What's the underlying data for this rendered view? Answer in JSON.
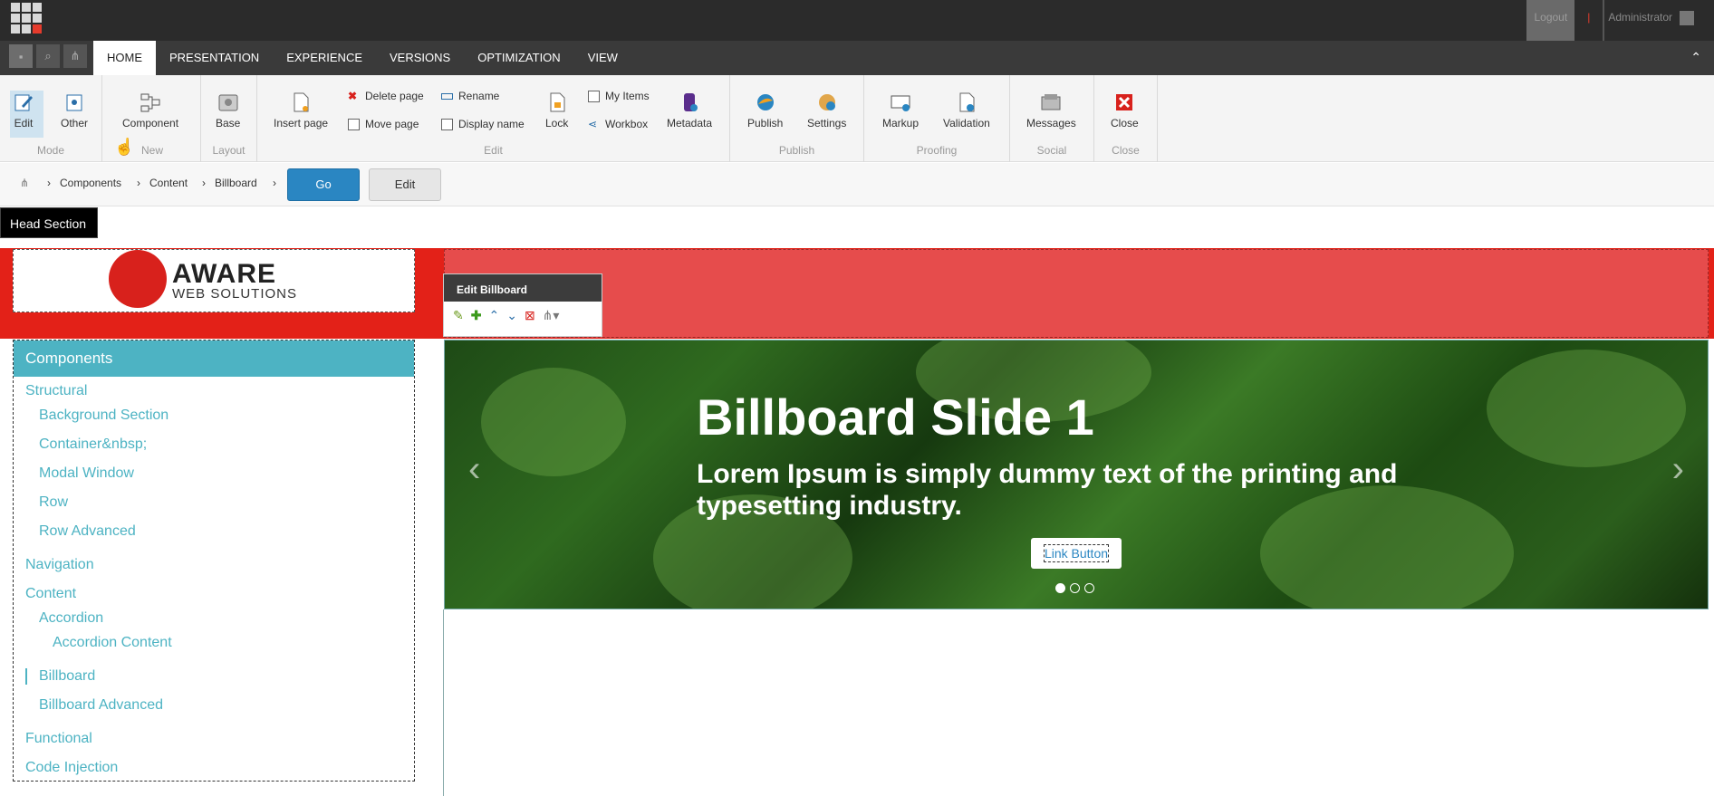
{
  "top": {
    "logout": "Logout",
    "separator": "|",
    "user": "Administrator"
  },
  "tabs": [
    "HOME",
    "PRESENTATION",
    "EXPERIENCE",
    "VERSIONS",
    "OPTIMIZATION",
    "VIEW"
  ],
  "ribbon": {
    "mode": {
      "label": "Mode",
      "edit": "Edit",
      "other": "Other"
    },
    "new": {
      "label": "New",
      "component": "Component"
    },
    "layout": {
      "label": "Layout",
      "base": "Base"
    },
    "edit": {
      "label": "Edit",
      "insert_page": "Insert page",
      "delete_page": "Delete page",
      "move_page": "Move page",
      "rename": "Rename",
      "display_name": "Display name",
      "lock": "Lock",
      "my_items": "My Items",
      "workbox": "Workbox",
      "metadata": "Metadata"
    },
    "publish": {
      "label": "Publish",
      "publish": "Publish",
      "settings": "Settings"
    },
    "proofing": {
      "label": "Proofing",
      "markup": "Markup",
      "validation": "Validation"
    },
    "social": {
      "label": "Social",
      "messages": "Messages"
    },
    "close": {
      "label": "Close",
      "close": "Close"
    }
  },
  "breadcrumb": {
    "items": [
      "Components",
      "Content",
      "Billboard"
    ],
    "go": "Go",
    "edit": "Edit"
  },
  "head_section": "Head Section",
  "logo": {
    "line1": "AWARE",
    "line2": "WEB SOLUTIONS"
  },
  "edit_billboard": {
    "title": "Edit Billboard"
  },
  "sidebar": {
    "title": "Components",
    "items": [
      "Structural",
      "Background Section",
      "Container&nbsp;",
      "Modal Window",
      "Row",
      "Row Advanced",
      "Navigation",
      "Content",
      "Accordion",
      "Accordion Content",
      "Billboard",
      "Billboard Advanced",
      "Functional",
      "Code Injection"
    ]
  },
  "hero": {
    "title": "Billboard Slide 1",
    "text": "Lorem Ipsum is simply dummy text of the printing and typesetting industry.",
    "button": "Link Button"
  },
  "colors": {
    "accent": "#4db3c3",
    "brand_red": "#e32118",
    "go_blue": "#2a86c2"
  }
}
